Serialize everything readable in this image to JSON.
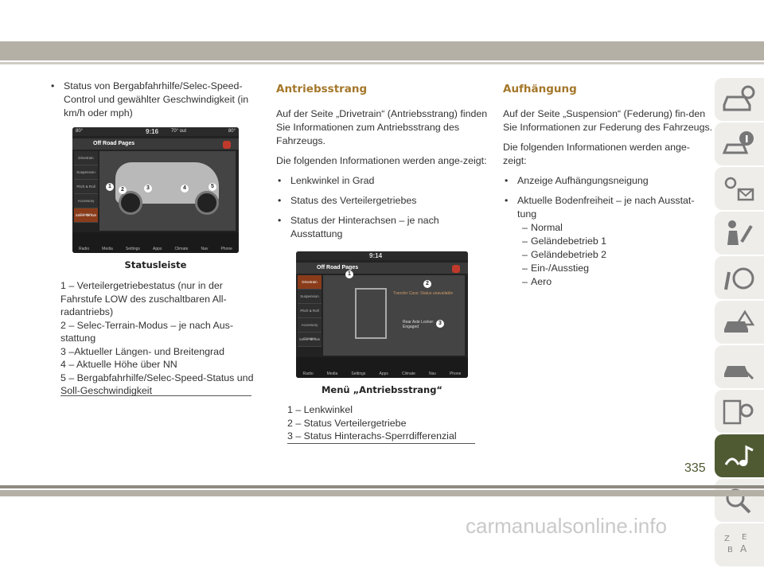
{
  "col1": {
    "bullet": "Status von Bergabfahrhilfe/Selec-Speed-Control und gewählter Geschwindigkeit (in km/h oder mph)",
    "screenshot": {
      "temp_left": "80°",
      "time": "9:16",
      "temp_out": "70° out",
      "temp_right": "80°",
      "title": "Off Road Pages",
      "side_items": [
        "Drivetrain",
        "Suspension",
        "Pitch & Roll",
        "Accessory Gauges",
        "Selec-Terrain"
      ],
      "markers": [
        "1",
        "2",
        "3",
        "4",
        "5"
      ],
      "dock": [
        "Radio",
        "Media",
        "Settings",
        "Apps",
        "Climate",
        "Nav",
        "Phone"
      ]
    },
    "caption": "Statusleiste",
    "legend": [
      "1 – Verteilergetriebestatus (nur in der Fahrstufe LOW des zuschaltbaren All-radantriebs)",
      "2 – Selec-Terrain-Modus – je nach Aus-stattung",
      "3 –Aktueller Längen- und Breitengrad",
      "4 – Aktuelle Höhe über NN",
      "5 – Bergabfahrhilfe/Selec-Speed-Status und Soll-Geschwindigkeit"
    ]
  },
  "col2": {
    "heading": "Antriebsstrang",
    "para1": "Auf der Seite „Drivetrain“ (Antriebsstrang) finden Sie Informationen zum Antriebsstrang des Fahrzeugs.",
    "para2": "Die folgenden Informationen werden ange-zeigt:",
    "bullets": [
      "Lenkwinkel in Grad",
      "Status des Verteilergetriebes",
      "Status der Hinterachsen – je nach Ausstattung"
    ],
    "screenshot": {
      "time": "9:14",
      "title": "Off Road Pages",
      "side_items": [
        "Drivetrain",
        "Suspension",
        "Pitch & Roll",
        "Accessory Gauges",
        "Selec-Terrain"
      ],
      "markers": [
        "1",
        "2",
        "3"
      ],
      "transfer_case": "Transfer Case: Status unavailable",
      "rear": "Rear Axle Locker: Engaged",
      "dock": [
        "Radio",
        "Media",
        "Settings",
        "Apps",
        "Climate",
        "Nav",
        "Phone"
      ]
    },
    "caption": "Menü „Antriebsstrang“",
    "legend": [
      "1 – Lenkwinkel",
      "2 – Status Verteilergetriebe",
      "3 – Status Hinterachs-Sperrdifferenzial"
    ]
  },
  "col3": {
    "heading": "Aufhängung",
    "para1": "Auf der Seite „Suspension“ (Federung) fin-den Sie Informationen zur Federung des Fahrzeugs.",
    "para2": "Die folgenden Informationen werden ange-zeigt:",
    "bullets": [
      "Anzeige Aufhängungsneigung",
      "Aktuelle Bodenfreiheit – je nach Ausstat-tung"
    ],
    "subitems": [
      "Normal",
      "Geländebetrieb 1",
      "Geländebetrieb 2",
      "Ein-/Ausstieg",
      "Aero"
    ]
  },
  "tabs": [
    "car-info-icon",
    "warning-info-icon",
    "lights-message-icon",
    "people-safety-icon",
    "steering-wrench-icon",
    "car-warning-icon",
    "car-tools-icon",
    "specs-gear-icon",
    "multimedia-note-icon",
    "search-icon",
    "index-letters-icon"
  ],
  "page_number": "335",
  "watermark": "carmanualsonline.info",
  "colors": {
    "heading": "#a4772a",
    "active_tab": "#4f5a33",
    "band": "#b5b0a6"
  }
}
